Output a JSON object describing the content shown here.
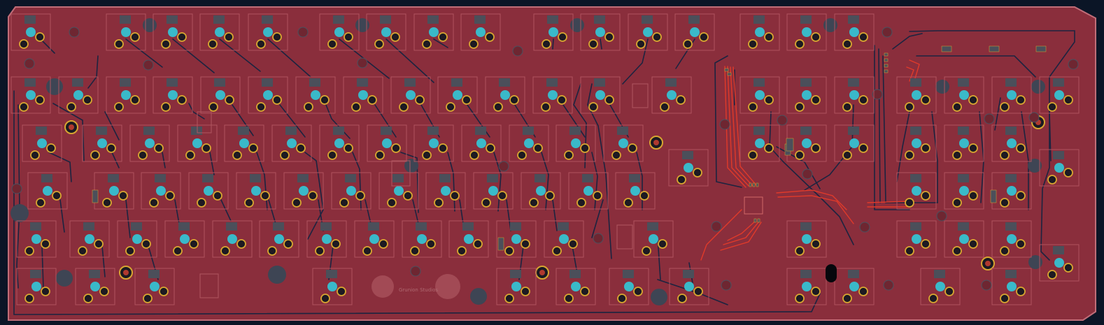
{
  "viewer": {
    "background_color": "#0b1526",
    "board_color": "#8a2e3c",
    "board_outline_color": "#c06d78",
    "trace_color": "#1c2440",
    "front_trace_color": "#e03a2a",
    "switch_pad_color": "#3ab9c9",
    "smd_pad_color": "#4b4f5a",
    "ring_color": "#d7a531",
    "hole_color": "#3e4554",
    "silkscreen_label": "Grunion Studios"
  }
}
